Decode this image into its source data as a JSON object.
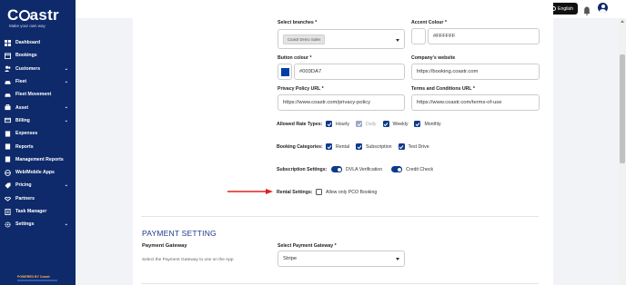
{
  "app": {
    "logo_text_pre": "C",
    "logo_text_post": "astr",
    "tagline": "Make your own way",
    "powered_by": "POWERED BY Coastr"
  },
  "sidebar": {
    "items": [
      {
        "label": "Dashboard",
        "icon": "dashboard-icon",
        "has_chevron": false
      },
      {
        "label": "Bookings",
        "icon": "bookings-icon",
        "has_chevron": false
      },
      {
        "label": "Customers",
        "icon": "customers-icon",
        "has_chevron": true
      },
      {
        "label": "Fleet",
        "icon": "fleet-icon",
        "has_chevron": true
      },
      {
        "label": "Fleet Movement",
        "icon": "fleet-movement-icon",
        "has_chevron": false
      },
      {
        "label": "Asset",
        "icon": "asset-icon",
        "has_chevron": true
      },
      {
        "label": "Billing",
        "icon": "billing-icon",
        "has_chevron": true
      },
      {
        "label": "Expenses",
        "icon": "expenses-icon",
        "has_chevron": false
      },
      {
        "label": "Reports",
        "icon": "reports-icon",
        "has_chevron": false
      },
      {
        "label": "Management Reports",
        "icon": "management-reports-icon",
        "has_chevron": false
      },
      {
        "label": "Web/Mobile Apps",
        "icon": "apps-icon",
        "has_chevron": false
      },
      {
        "label": "Pricing",
        "icon": "pricing-icon",
        "has_chevron": true
      },
      {
        "label": "Partners",
        "icon": "partners-icon",
        "has_chevron": false
      },
      {
        "label": "Task Manager",
        "icon": "task-manager-icon",
        "has_chevron": false
      },
      {
        "label": "Settings",
        "icon": "settings-icon",
        "has_chevron": true
      }
    ]
  },
  "topbar": {
    "language": "English"
  },
  "form": {
    "branches_label": "Select branches *",
    "branches_chip": "Coastr Demo Sales",
    "accent_label": "Accent Colour *",
    "accent_value": "#FFFFFF",
    "button_label": "Button colour *",
    "button_value": "#003DA7",
    "website_label": "Company's website",
    "website_value": "https://booking.coastr.com",
    "privacy_label": "Privacy Policy URL *",
    "privacy_value": "https://www.coastr.com/privacy-policy",
    "terms_label": "Terms and Conditions URL *",
    "terms_value": "https://www.coastr.com/terms-of-use",
    "rate_types_label": "Allowed Rate Types:",
    "rate_types": [
      "Hourly",
      "Daily",
      "Weekly",
      "Monthly"
    ],
    "categories_label": "Booking Categories:",
    "categories": [
      "Rental",
      "Subscription",
      "Test Drive"
    ],
    "subscription_label": "Subscription Settings:",
    "subscription_options": [
      "DVLA Verification",
      "Credit Check"
    ],
    "rental_label": "Rental Settings:",
    "rental_option": "Allow only PCO Booking"
  },
  "payment": {
    "section_title": "PAYMENT SETTING",
    "gateway_title": "Payment Gateway",
    "gateway_desc": "Select the Payment Gateway to use on the App",
    "select_label": "Select Payment Gateway *",
    "select_value": "Stripe"
  },
  "colors": {
    "sidebar_bg": "#0e2a6b",
    "accent": "#003DA7",
    "arrow": "#e02020"
  }
}
